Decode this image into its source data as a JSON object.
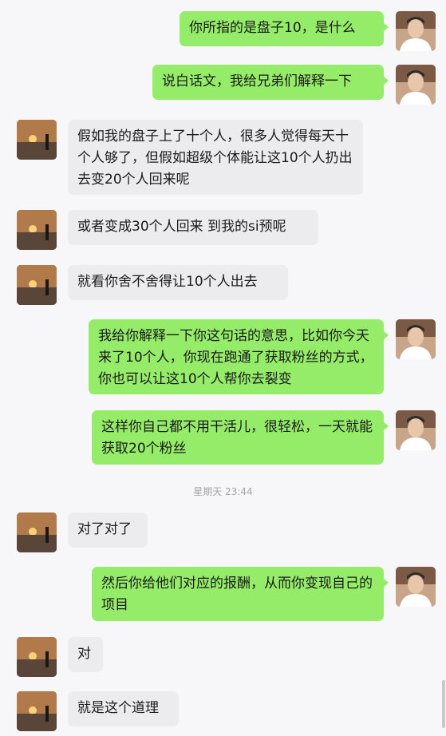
{
  "messages": [
    {
      "side": "me",
      "text": "你所指的是盘子10，是什么"
    },
    {
      "side": "me",
      "text": "说白话文，我给兄弟们解释一下"
    },
    {
      "side": "them",
      "text": "假如我的盘子上了十个人，很多人觉得每天十个人够了，但假如超级个体能让这10个人扔出去变20个人回来呢"
    },
    {
      "side": "them",
      "text": "或者变成30个人回来 到我的si预呢"
    },
    {
      "side": "them",
      "text": "就看你舍不舍得让10个人出去"
    },
    {
      "side": "me",
      "text": "我给你解释一下你这句话的意思，比如你今天来了10个人，你现在跑通了获取粉丝的方式，你也可以让这10个人帮你去裂变"
    },
    {
      "side": "me",
      "text": "这样你自己都不用干活儿，很轻松，一天就能获取20个粉丝"
    },
    {
      "side": "them",
      "text": "对了对了"
    },
    {
      "side": "me",
      "text": "然后你给他们对应的报酬，从而你变现自己的项目"
    },
    {
      "side": "them",
      "text": "对"
    },
    {
      "side": "them",
      "text": "就是这个道理"
    }
  ],
  "timestamp": "星期天 23:44",
  "colors": {
    "my_bubble": "#95ec69",
    "their_bubble": "#ececee",
    "background": "#f7f7f9"
  }
}
